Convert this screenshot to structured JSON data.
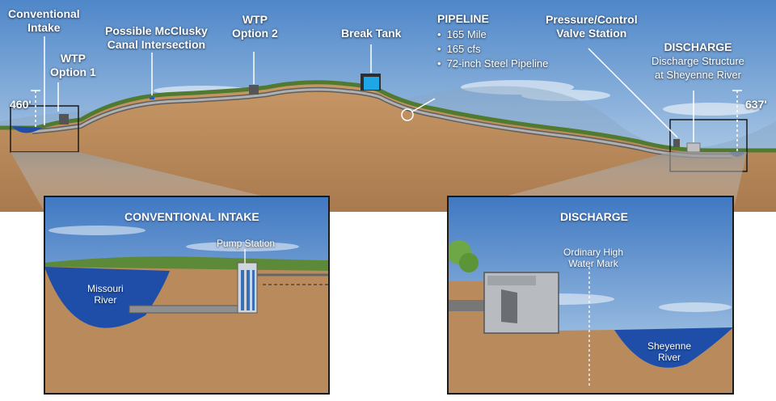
{
  "overview": {
    "elevation_left": "460'",
    "elevation_right": "637'",
    "labels": {
      "conventional_intake": [
        "Conventional",
        "Intake"
      ],
      "wtp_option1": [
        "WTP",
        "Option 1"
      ],
      "mcclusky": [
        "Possible McClusky",
        "Canal Intersection"
      ],
      "wtp_option2": [
        "WTP",
        "Option 2"
      ],
      "break_tank": "Break Tank",
      "pipeline_title": "PIPELINE",
      "pipeline_items": [
        "165 Mile",
        "165 cfs",
        "72-inch Steel Pipeline"
      ],
      "pressure_valve": [
        "Pressure/Control",
        "Valve Station"
      ],
      "discharge_title": "DISCHARGE",
      "discharge_sub": [
        "Discharge Structure",
        "at Sheyenne River"
      ]
    }
  },
  "inset_intake": {
    "title": "CONVENTIONAL INTAKE",
    "pump_station": "Pump Station",
    "river": [
      "Missouri",
      "River"
    ]
  },
  "inset_discharge": {
    "title": "DISCHARGE",
    "water_mark": [
      "Ordinary High",
      "Water Mark"
    ],
    "river": [
      "Sheyenne",
      "River"
    ]
  },
  "colors": {
    "sky_top": "#4f87c9",
    "sky_bottom": "#c6dcee",
    "soil": "#b98a5c",
    "grass": "#5f8a3a",
    "water": "#1e4ea8",
    "pipe": "#8f8f8f"
  }
}
